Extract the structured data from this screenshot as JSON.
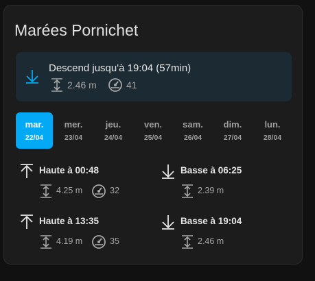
{
  "card": {
    "title": "Marées Pornichet"
  },
  "current": {
    "text": "Descend jusqu'à 19:04 (57min)",
    "height": "2.46 m",
    "coefficient": "41",
    "icon": "arrow-down-icon",
    "accent": "#03a9f4"
  },
  "days": [
    {
      "name": "mar.",
      "date": "22/04",
      "active": true
    },
    {
      "name": "mer.",
      "date": "23/04"
    },
    {
      "name": "jeu.",
      "date": "24/04"
    },
    {
      "name": "ven.",
      "date": "25/04"
    },
    {
      "name": "sam.",
      "date": "26/04"
    },
    {
      "name": "dim.",
      "date": "27/04"
    },
    {
      "name": "lun.",
      "date": "28/04"
    }
  ],
  "tides": [
    {
      "label": "Haute à 00:48",
      "height": "4.25 m",
      "coefficient": "32",
      "direction": "up"
    },
    {
      "label": "Basse à 06:25",
      "height": "2.39 m",
      "direction": "down"
    },
    {
      "label": "Haute à 13:35",
      "height": "4.19 m",
      "coefficient": "35",
      "direction": "up"
    },
    {
      "label": "Basse à 19:04",
      "height": "2.46 m",
      "direction": "down"
    }
  ]
}
